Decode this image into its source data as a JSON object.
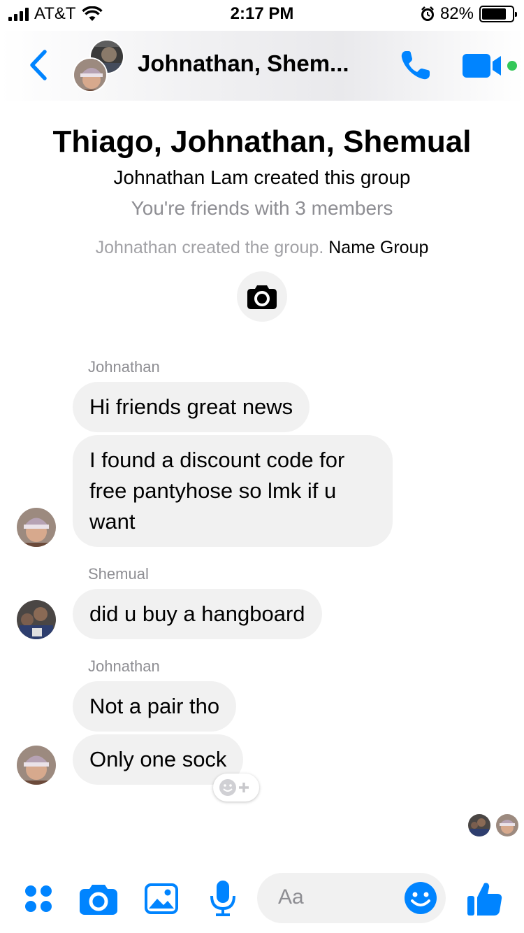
{
  "status_bar": {
    "carrier": "AT&T",
    "time": "2:17 PM",
    "battery": "82%",
    "battery_level": 0.82
  },
  "header": {
    "title": "Johnathan, Shem..."
  },
  "intro": {
    "group_name": "Thiago, Johnathan, Shemual",
    "created_by": "Johnathan Lam created this group",
    "friends_info": "You're friends with 3 members",
    "event_text": "Johnathan created the group.",
    "event_link": "Name Group"
  },
  "messages": [
    {
      "sender": "Johnathan",
      "bubbles": [
        "Hi friends great news",
        "I found a discount code for free pantyhose so lmk if u want"
      ]
    },
    {
      "sender": "Shemual",
      "bubbles": [
        "did u buy a hangboard"
      ]
    },
    {
      "sender": "Johnathan",
      "bubbles": [
        "Not a pair tho",
        "Only one sock"
      ]
    }
  ],
  "composer": {
    "placeholder": "Aa"
  },
  "icons": [
    "back-arrow-icon",
    "phone-icon",
    "video-camera-icon",
    "camera-icon",
    "apps-icon",
    "photo-icon",
    "microphone-icon",
    "emoji-icon",
    "thumbs-up-icon",
    "add-reaction-icon"
  ],
  "colors": {
    "accent": "#0084ff",
    "bubble": "#f1f1f1",
    "meta_text": "#8e8e93",
    "online": "#34c759"
  }
}
